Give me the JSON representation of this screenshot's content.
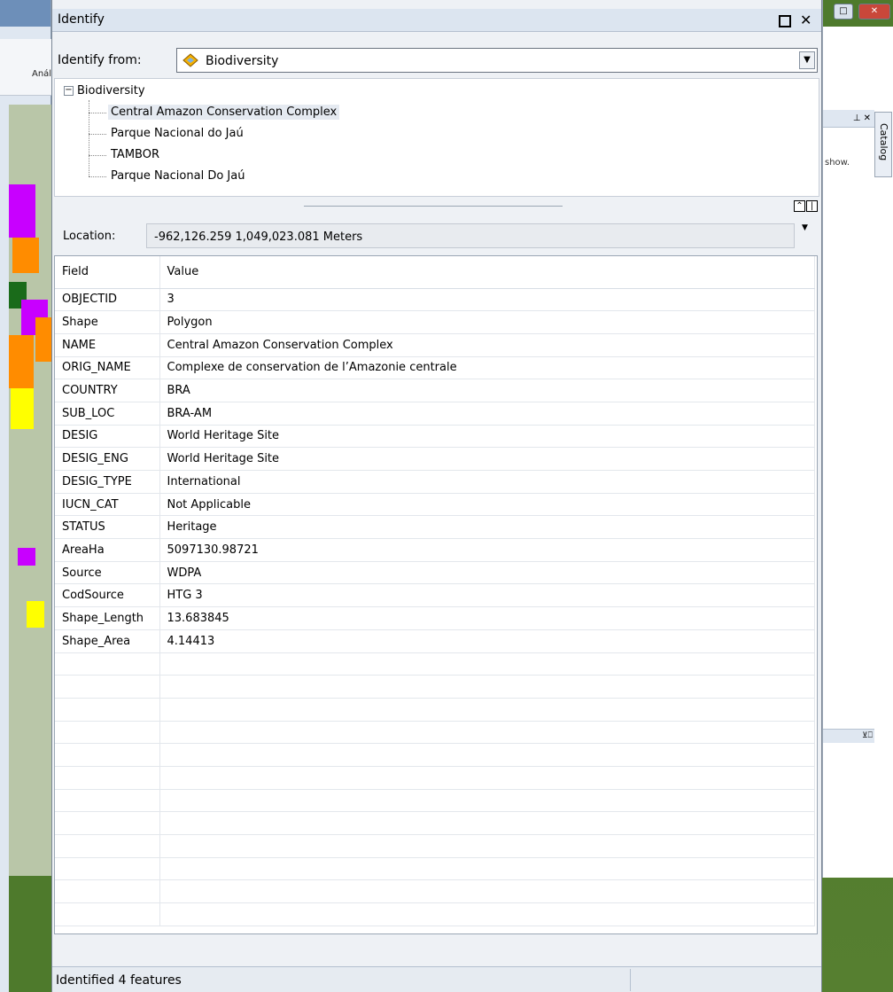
{
  "window": {
    "title": "Identify"
  },
  "identify_from": {
    "label": "Identify from:",
    "selected": "Biodiversity"
  },
  "tree": {
    "root": "Biodiversity",
    "children": [
      "Central Amazon Conservation Complex",
      "Parque Nacional do Jaú",
      "TAMBOR",
      "Parque Nacional Do Jaú"
    ]
  },
  "location": {
    "label": "Location:",
    "value": "-962,126.259  1,049,023.081 Meters"
  },
  "grid": {
    "headers": [
      "Field",
      "Value"
    ],
    "rows": [
      [
        "OBJECTID",
        "3"
      ],
      [
        "Shape",
        "Polygon"
      ],
      [
        "NAME",
        "Central Amazon Conservation Complex"
      ],
      [
        "ORIG_NAME",
        "Complexe de conservation de l’Amazonie centrale"
      ],
      [
        "COUNTRY",
        "BRA"
      ],
      [
        "SUB_LOC",
        "BRA-AM"
      ],
      [
        "DESIG",
        "World Heritage Site"
      ],
      [
        "DESIG_ENG",
        "World Heritage Site"
      ],
      [
        "DESIG_TYPE",
        "International"
      ],
      [
        "IUCN_CAT",
        "Not Applicable"
      ],
      [
        "STATUS",
        "Heritage"
      ],
      [
        "AreaHa",
        "5097130.98721"
      ],
      [
        "Source",
        "WDPA"
      ],
      [
        "CodSource",
        "HTG 3"
      ],
      [
        "Shape_Length",
        "13.683845"
      ],
      [
        "Shape_Area",
        "4.14413"
      ]
    ]
  },
  "status": {
    "text": "Identified 4 features"
  },
  "background": {
    "left_tab": "Anális",
    "right_panel_text": "show.",
    "catalog_tab": "Catalog"
  }
}
